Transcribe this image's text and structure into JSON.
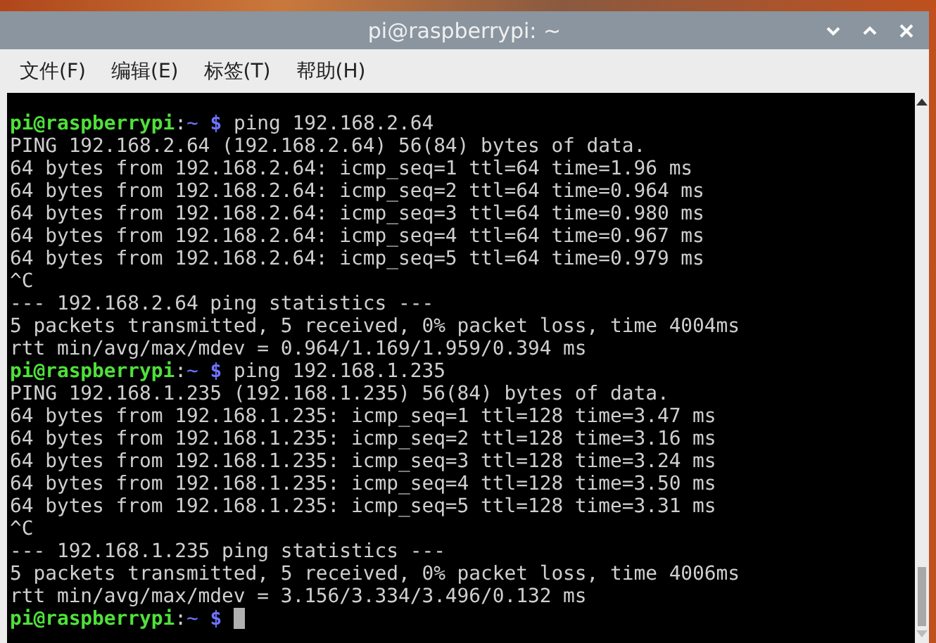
{
  "window": {
    "title": "pi@raspberrypi: ~"
  },
  "menu": [
    "文件(F)",
    "编辑(E)",
    "标签(T)",
    "帮助(H)"
  ],
  "terminal": {
    "lines": [
      {
        "kind": "prompt",
        "user": "pi@raspberrypi",
        "sep": ":",
        "path": "~",
        "symbol": "$",
        "command": "ping 192.168.2.64"
      },
      {
        "kind": "output",
        "text": "PING 192.168.2.64 (192.168.2.64) 56(84) bytes of data."
      },
      {
        "kind": "output",
        "text": "64 bytes from 192.168.2.64: icmp_seq=1 ttl=64 time=1.96 ms"
      },
      {
        "kind": "output",
        "text": "64 bytes from 192.168.2.64: icmp_seq=2 ttl=64 time=0.964 ms"
      },
      {
        "kind": "output",
        "text": "64 bytes from 192.168.2.64: icmp_seq=3 ttl=64 time=0.980 ms"
      },
      {
        "kind": "output",
        "text": "64 bytes from 192.168.2.64: icmp_seq=4 ttl=64 time=0.967 ms"
      },
      {
        "kind": "output",
        "text": "64 bytes from 192.168.2.64: icmp_seq=5 ttl=64 time=0.979 ms"
      },
      {
        "kind": "output",
        "text": "^C"
      },
      {
        "kind": "output",
        "text": "--- 192.168.2.64 ping statistics ---"
      },
      {
        "kind": "output",
        "text": "5 packets transmitted, 5 received, 0% packet loss, time 4004ms"
      },
      {
        "kind": "output",
        "text": "rtt min/avg/max/mdev = 0.964/1.169/1.959/0.394 ms"
      },
      {
        "kind": "prompt",
        "user": "pi@raspberrypi",
        "sep": ":",
        "path": "~",
        "symbol": "$",
        "command": "ping 192.168.1.235"
      },
      {
        "kind": "output",
        "text": "PING 192.168.1.235 (192.168.1.235) 56(84) bytes of data."
      },
      {
        "kind": "output",
        "text": "64 bytes from 192.168.1.235: icmp_seq=1 ttl=128 time=3.47 ms"
      },
      {
        "kind": "output",
        "text": "64 bytes from 192.168.1.235: icmp_seq=2 ttl=128 time=3.16 ms"
      },
      {
        "kind": "output",
        "text": "64 bytes from 192.168.1.235: icmp_seq=3 ttl=128 time=3.24 ms"
      },
      {
        "kind": "output",
        "text": "64 bytes from 192.168.1.235: icmp_seq=4 ttl=128 time=3.50 ms"
      },
      {
        "kind": "output",
        "text": "64 bytes from 192.168.1.235: icmp_seq=5 ttl=128 time=3.31 ms"
      },
      {
        "kind": "output",
        "text": "^C"
      },
      {
        "kind": "output",
        "text": "--- 192.168.1.235 ping statistics ---"
      },
      {
        "kind": "output",
        "text": "5 packets transmitted, 5 received, 0% packet loss, time 4006ms"
      },
      {
        "kind": "output",
        "text": "rtt min/avg/max/mdev = 3.156/3.334/3.496/0.132 ms"
      },
      {
        "kind": "prompt",
        "user": "pi@raspberrypi",
        "sep": ":",
        "path": "~",
        "symbol": "$",
        "cursor": true
      }
    ]
  }
}
